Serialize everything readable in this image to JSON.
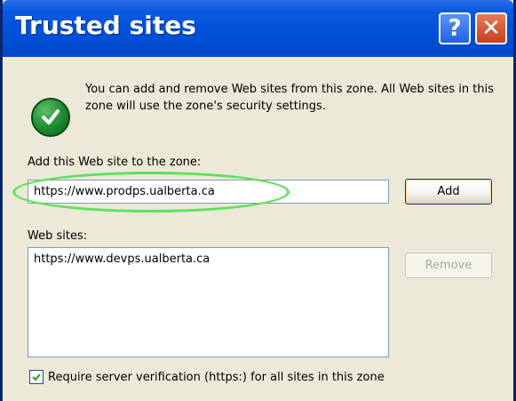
{
  "window": {
    "title": "Trusted sites",
    "help_glyph": "?",
    "close_glyph": "✕"
  },
  "info": {
    "icon": "green-checkmark-icon",
    "text": "You can add and remove Web sites from this zone. All Web sites in this zone will use the zone's security settings."
  },
  "add_section": {
    "label": "Add this Web site to the zone:",
    "input_value": "https://www.prodps.ualberta.ca",
    "add_button": "Add"
  },
  "sites_section": {
    "label": "Web sites:",
    "items": [
      "https://www.devps.ualberta.ca"
    ],
    "remove_button": "Remove"
  },
  "verification": {
    "checked": true,
    "label": "Require server verification (https:) for all sites in this zone"
  },
  "colors": {
    "titlebar": "#0050d8",
    "highlight": "#5fe05a",
    "check_icon": "#1e8a2e"
  }
}
